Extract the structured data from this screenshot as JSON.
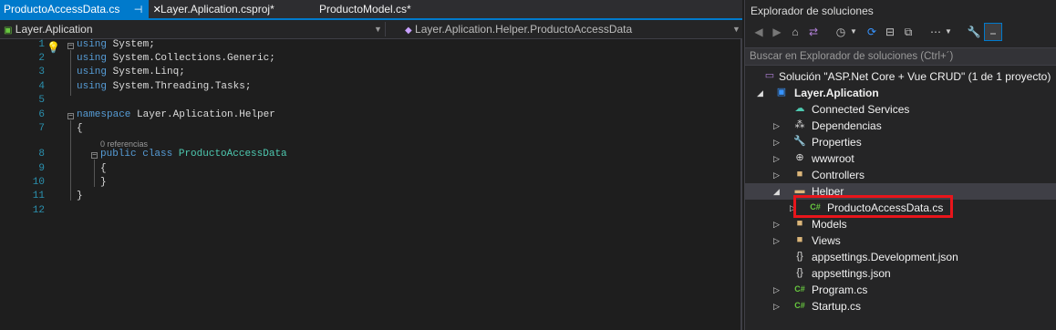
{
  "tabs": [
    {
      "label": "ProductoAccessData.cs",
      "pin": "⊣",
      "close": "✕",
      "active": true
    },
    {
      "label": "Layer.Aplication.csproj*",
      "active": false
    },
    {
      "label": "ProductoModel.cs*",
      "active": false
    }
  ],
  "navbar": {
    "project": "Layer.Aplication",
    "type": "Layer.Aplication.Helper.ProductoAccessData"
  },
  "editor": {
    "line_numbers": [
      "1",
      "2",
      "3",
      "4",
      "5",
      "6",
      "7",
      "8",
      "9",
      "10",
      "11",
      "12"
    ],
    "codelens": "0 referencias",
    "lines": {
      "l1_kw": "using",
      "l1_rest": " System;",
      "l2_kw": "using",
      "l2_rest": " System.Collections.Generic;",
      "l3_kw": "using",
      "l3_rest": " System.Linq;",
      "l4_kw": "using",
      "l4_rest": " System.Threading.Tasks;",
      "l6_kw": "namespace",
      "l6_rest": " Layer.Aplication.Helper",
      "l7": "{",
      "l8_kw1": "public",
      "l8_kw2": "class",
      "l8_cls": "ProductoAccessData",
      "l9": "{",
      "l10": "}",
      "l11": "}"
    }
  },
  "solution_explorer": {
    "title": "Explorador de soluciones",
    "search_placeholder": "Buscar en Explorador de soluciones (Ctrl+´)",
    "items": [
      {
        "label": "Solución \"ASP.Net Core + Vue CRUD\" (1 de 1 proyecto)",
        "icon": "solution-icon"
      },
      {
        "label": "Layer.Aplication",
        "icon": "csharp-project-icon",
        "bold": true
      },
      {
        "label": "Connected Services",
        "icon": "connected-services-icon"
      },
      {
        "label": "Dependencias",
        "icon": "dependencies-icon"
      },
      {
        "label": "Properties",
        "icon": "properties-icon"
      },
      {
        "label": "wwwroot",
        "icon": "globe-icon"
      },
      {
        "label": "Controllers",
        "icon": "folder-icon"
      },
      {
        "label": "Helper",
        "icon": "open-folder-icon"
      },
      {
        "label": "ProductoAccessData.cs",
        "icon": "csharp-file-icon"
      },
      {
        "label": "Models",
        "icon": "folder-icon"
      },
      {
        "label": "Views",
        "icon": "folder-icon"
      },
      {
        "label": "appsettings.Development.json",
        "icon": "json-file-icon"
      },
      {
        "label": "appsettings.json",
        "icon": "json-file-icon"
      },
      {
        "label": "Program.cs",
        "icon": "csharp-file-icon"
      },
      {
        "label": "Startup.cs",
        "icon": "csharp-file-icon"
      }
    ]
  },
  "colors": {
    "accent": "#007acc",
    "highlight_box": "#e8151b",
    "keyword": "#569cd6",
    "class_name": "#4ec9b0",
    "line_number": "#2b91af"
  }
}
